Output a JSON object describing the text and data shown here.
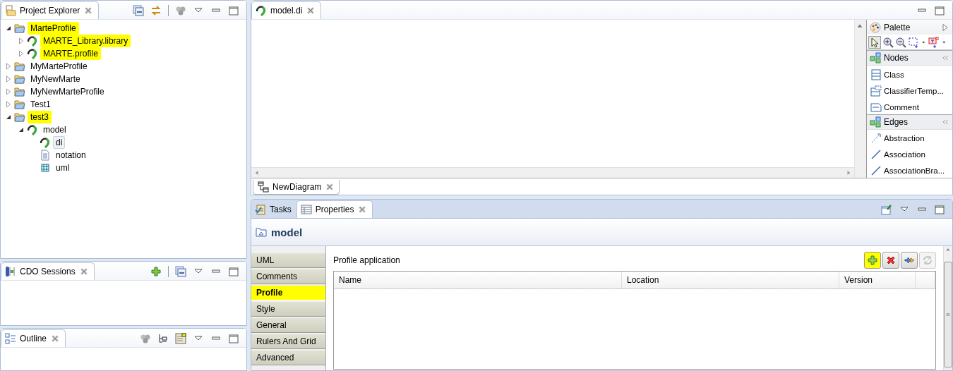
{
  "project_explorer": {
    "title": "Project Explorer",
    "tree": [
      {
        "label": "MarteProfile",
        "kind": "project",
        "expanded": true,
        "highlighted": true,
        "selected": false,
        "children": [
          {
            "label": "MARTE_Library.library",
            "kind": "model",
            "expanded": false,
            "highlighted": true,
            "selected": false
          },
          {
            "label": "MARTE.profile",
            "kind": "model",
            "expanded": false,
            "highlighted": true,
            "selected": false
          }
        ]
      },
      {
        "label": "MyMarteProfile",
        "kind": "project",
        "expanded": false,
        "highlighted": false,
        "selected": false
      },
      {
        "label": "MyNewMarte",
        "kind": "project",
        "expanded": false,
        "highlighted": false,
        "selected": false
      },
      {
        "label": "MyNewMarteProfile",
        "kind": "project",
        "expanded": false,
        "highlighted": false,
        "selected": false
      },
      {
        "label": "Test1",
        "kind": "project",
        "expanded": false,
        "highlighted": false,
        "selected": false
      },
      {
        "label": "test3",
        "kind": "project",
        "expanded": true,
        "highlighted": true,
        "selected": false,
        "children": [
          {
            "label": "model",
            "kind": "model",
            "expanded": true,
            "highlighted": false,
            "selected": false,
            "children": [
              {
                "label": "di",
                "kind": "model",
                "highlighted": false,
                "selected": true
              },
              {
                "label": "notation",
                "kind": "file",
                "highlighted": false,
                "selected": false
              },
              {
                "label": "uml",
                "kind": "uml",
                "highlighted": false,
                "selected": false
              }
            ]
          }
        ]
      }
    ]
  },
  "cdo_sessions": {
    "title": "CDO Sessions"
  },
  "outline": {
    "title": "Outline"
  },
  "editor": {
    "tab": "model.di",
    "diagram_tab": "NewDiagram",
    "palette": {
      "title": "Palette",
      "drawers": [
        {
          "title": "Nodes",
          "tools": [
            {
              "label": "Class",
              "kind": "class"
            },
            {
              "label": "ClassifierTemp...",
              "kind": "template"
            },
            {
              "label": "Comment",
              "kind": "comment"
            }
          ]
        },
        {
          "title": "Edges",
          "tools": [
            {
              "label": "Abstraction",
              "kind": "abstraction"
            },
            {
              "label": "Association",
              "kind": "line"
            },
            {
              "label": "AssociationBra...",
              "kind": "line"
            }
          ]
        }
      ]
    }
  },
  "properties": {
    "tabs": [
      {
        "label": "Tasks",
        "kind": "tasks",
        "selected": false
      },
      {
        "label": "Properties",
        "kind": "properties",
        "selected": true
      }
    ],
    "title": "model",
    "sections": [
      {
        "label": "UML",
        "selected": false,
        "highlighted": false
      },
      {
        "label": "Comments",
        "selected": false,
        "highlighted": false
      },
      {
        "label": "Profile",
        "selected": true,
        "highlighted": true
      },
      {
        "label": "Style",
        "selected": false,
        "highlighted": false
      },
      {
        "label": "General",
        "selected": false,
        "highlighted": false
      },
      {
        "label": "Rulers And Grid",
        "selected": false,
        "highlighted": false
      },
      {
        "label": "Advanced",
        "selected": false,
        "highlighted": false
      }
    ],
    "section_title": "Profile application",
    "buttons": [
      {
        "kind": "add",
        "highlighted": true,
        "disabled": false
      },
      {
        "kind": "remove",
        "highlighted": false,
        "disabled": false
      },
      {
        "kind": "apply",
        "highlighted": false,
        "disabled": false
      },
      {
        "kind": "refresh",
        "highlighted": false,
        "disabled": true
      }
    ],
    "table": {
      "columns": [
        "Name",
        "Location",
        "Version"
      ]
    }
  }
}
